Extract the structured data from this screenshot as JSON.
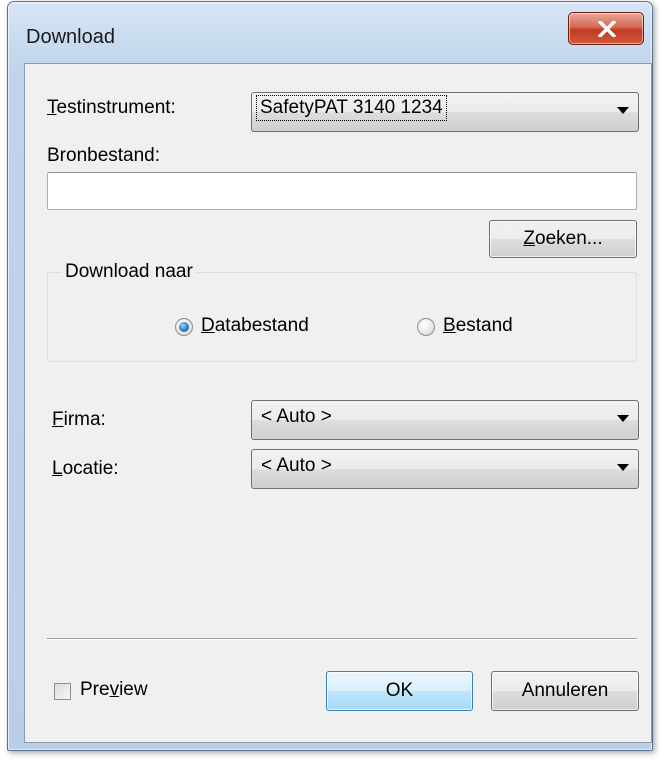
{
  "window": {
    "title": "Download",
    "close_glyph": "✕",
    "colors": {
      "close_button": "#c13a22",
      "frame": "#bfd4ea",
      "client": "#f0f0f0"
    }
  },
  "form": {
    "instrument_label": "Testinstrument:",
    "instrument_value": "SafetyPAT 3140 1234",
    "source_file_label": "Bronbestand:",
    "source_file_value": "",
    "search_button": "Zoeken...",
    "download_to": {
      "title": "Download naar",
      "options": [
        "Databestand",
        "Bestand"
      ],
      "selected": "Databestand"
    },
    "company_label": "Firma:",
    "company_value": "< Auto >",
    "location_label": "Locatie:",
    "location_value": "< Auto >"
  },
  "footer": {
    "preview_label": "Preview",
    "preview_checked": false,
    "ok_button": "OK",
    "cancel_button": "Annuleren"
  }
}
